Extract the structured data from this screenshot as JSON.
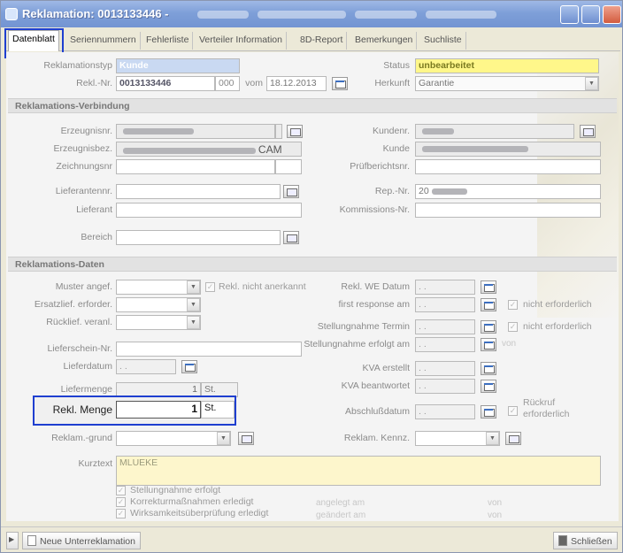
{
  "window": {
    "title": "Reklamation:  0013133446 -",
    "colors": {
      "titlebar": "#7e9fd8",
      "highlight": "#1f3fd0",
      "status_bg": "#fff78a",
      "kurztext_bg": "#fdf6cc"
    }
  },
  "tabs": [
    {
      "label": "Datenblatt",
      "active": true
    },
    {
      "label": "Seriennummern"
    },
    {
      "label": "Fehlerliste"
    },
    {
      "label": "Verteiler Information"
    },
    {
      "label": "8D-Report"
    },
    {
      "label": "Bemerkungen"
    },
    {
      "label": "Suchliste"
    }
  ],
  "header": {
    "reklamationstyp_label": "Reklamationstyp",
    "reklamationstyp_value": "Kunde",
    "reklnr_label": "Rekl.-Nr.",
    "reklnr_value": "0013133446",
    "reklnr_suffix": "000",
    "vom_label": "vom",
    "vom_value": "18.12.2013",
    "status_label": "Status",
    "status_value": "unbearbeitet",
    "herkunft_label": "Herkunft",
    "herkunft_value": "Garantie"
  },
  "verbindung": {
    "section_title": "Reklamations-Verbindung",
    "erzeugnisnr_label": "Erzeugnisnr.",
    "erzeugnisbez_label": "Erzeugnisbez.",
    "erzeugnisbez_suffix": "CAM",
    "zeichnungsnr_label": "Zeichnungsnr",
    "lieferantennr_label": "Lieferantennr.",
    "lieferant_label": "Lieferant",
    "bereich_label": "Bereich",
    "kundennr_label": "Kundenr.",
    "kunde_label": "Kunde",
    "pruefbericht_label": "Prüfberichtsnr.",
    "repnr_label": "Rep.-Nr.",
    "repnr_value": "20",
    "kommission_label": "Kommissions-Nr."
  },
  "daten": {
    "section_title": "Reklamations-Daten",
    "muster_label": "Muster angef.",
    "rekl_nicht_anerkannt": "Rekl. nicht anerkannt",
    "ersatzlief_label": "Ersatzlief. erforder.",
    "ruecklief_label": "Rücklief. veranl.",
    "lieferschein_label": "Lieferschein-Nr.",
    "lieferdatum_label": "Lieferdatum",
    "date_placeholder": ". .",
    "liefermenge_label": "Liefermenge",
    "liefermenge_value": "1",
    "unit": "St.",
    "rekl_menge_label": "Rekl. Menge",
    "rekl_menge_value": "1",
    "reklamgrund_label": "Reklam.-grund",
    "rekl_we_datum_label": "Rekl. WE Datum",
    "first_response_label": "first response am",
    "stellungnahme_termin_label": "Stellungnahme Termin",
    "stellungnahme_erfolgt_am_label": "Stellungnahme erfolgt am",
    "kva_erstellt_label": "KVA erstellt",
    "kva_beantwortet_label": "KVA beantwortet",
    "abschluss_label": "Abschlußdatum",
    "reklam_kennz_label": "Reklam. Kennz.",
    "nicht_erforderlich_1": "nicht erforderlich",
    "nicht_erforderlich_2": "nicht erforderlich",
    "von_label": "von",
    "rueckruf_line1": "Rückruf",
    "rueckruf_line2": "erforderlich",
    "kurztext_label": "Kurztext",
    "kurztext_value": "MLUEKE"
  },
  "footer_checks": {
    "stellungnahme": "Stellungnahme erfolgt",
    "korrektur": "Korrekturmaßnahmen erledigt",
    "wirksamkeit": "Wirksamkeitsüberprüfung erledigt",
    "angelegt_am": "angelegt am",
    "geaendert_am": "geändert am",
    "von1": "von",
    "von2": "von"
  },
  "statusbar": {
    "new_sub_label": "Neue Unterreklamation",
    "close_label": "Schließen"
  }
}
